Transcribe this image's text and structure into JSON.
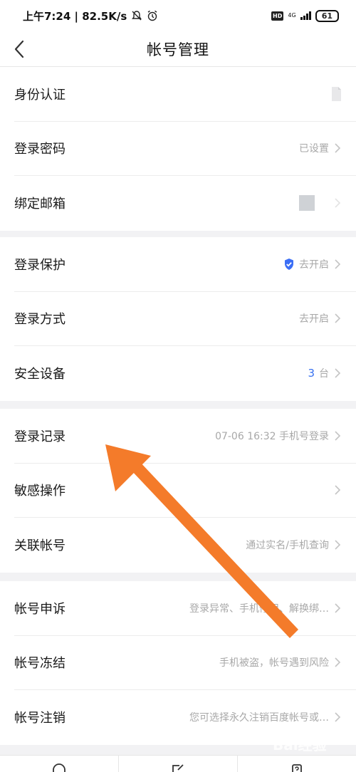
{
  "status_bar": {
    "time_speed": "上午7:24 | 82.5K/s",
    "hd": "HD",
    "network": "4G",
    "battery": "61"
  },
  "header": {
    "title": "帐号管理"
  },
  "groups": [
    {
      "items": [
        {
          "label": "身份认证",
          "value": ""
        },
        {
          "label": "登录密码",
          "value": "已设置"
        },
        {
          "label": "绑定邮箱",
          "value": ""
        }
      ]
    },
    {
      "items": [
        {
          "label": "登录保护",
          "value": "去开启"
        },
        {
          "label": "登录方式",
          "value": "去开启"
        },
        {
          "label": "安全设备",
          "count": "3",
          "value": "台"
        }
      ]
    },
    {
      "items": [
        {
          "label": "登录记录",
          "value": "07-06 16:32 手机号登录"
        },
        {
          "label": "敏感操作",
          "value": ""
        },
        {
          "label": "关联帐号",
          "value": "通过实名/手机查询"
        }
      ]
    },
    {
      "items": [
        {
          "label": "帐号申诉",
          "value": "登录异常、手机停用、解换绑…"
        },
        {
          "label": "帐号冻结",
          "value": "手机被盗，帐号遇到风险"
        },
        {
          "label": "帐号注销",
          "value": "您可选择永久注销百度帐号或…"
        }
      ]
    }
  ],
  "icons": {
    "shield_color": "#3b6ef5",
    "arrow_color": "#f47b2a",
    "accent_color": "#3670f0"
  },
  "watermark": "Bai经验"
}
